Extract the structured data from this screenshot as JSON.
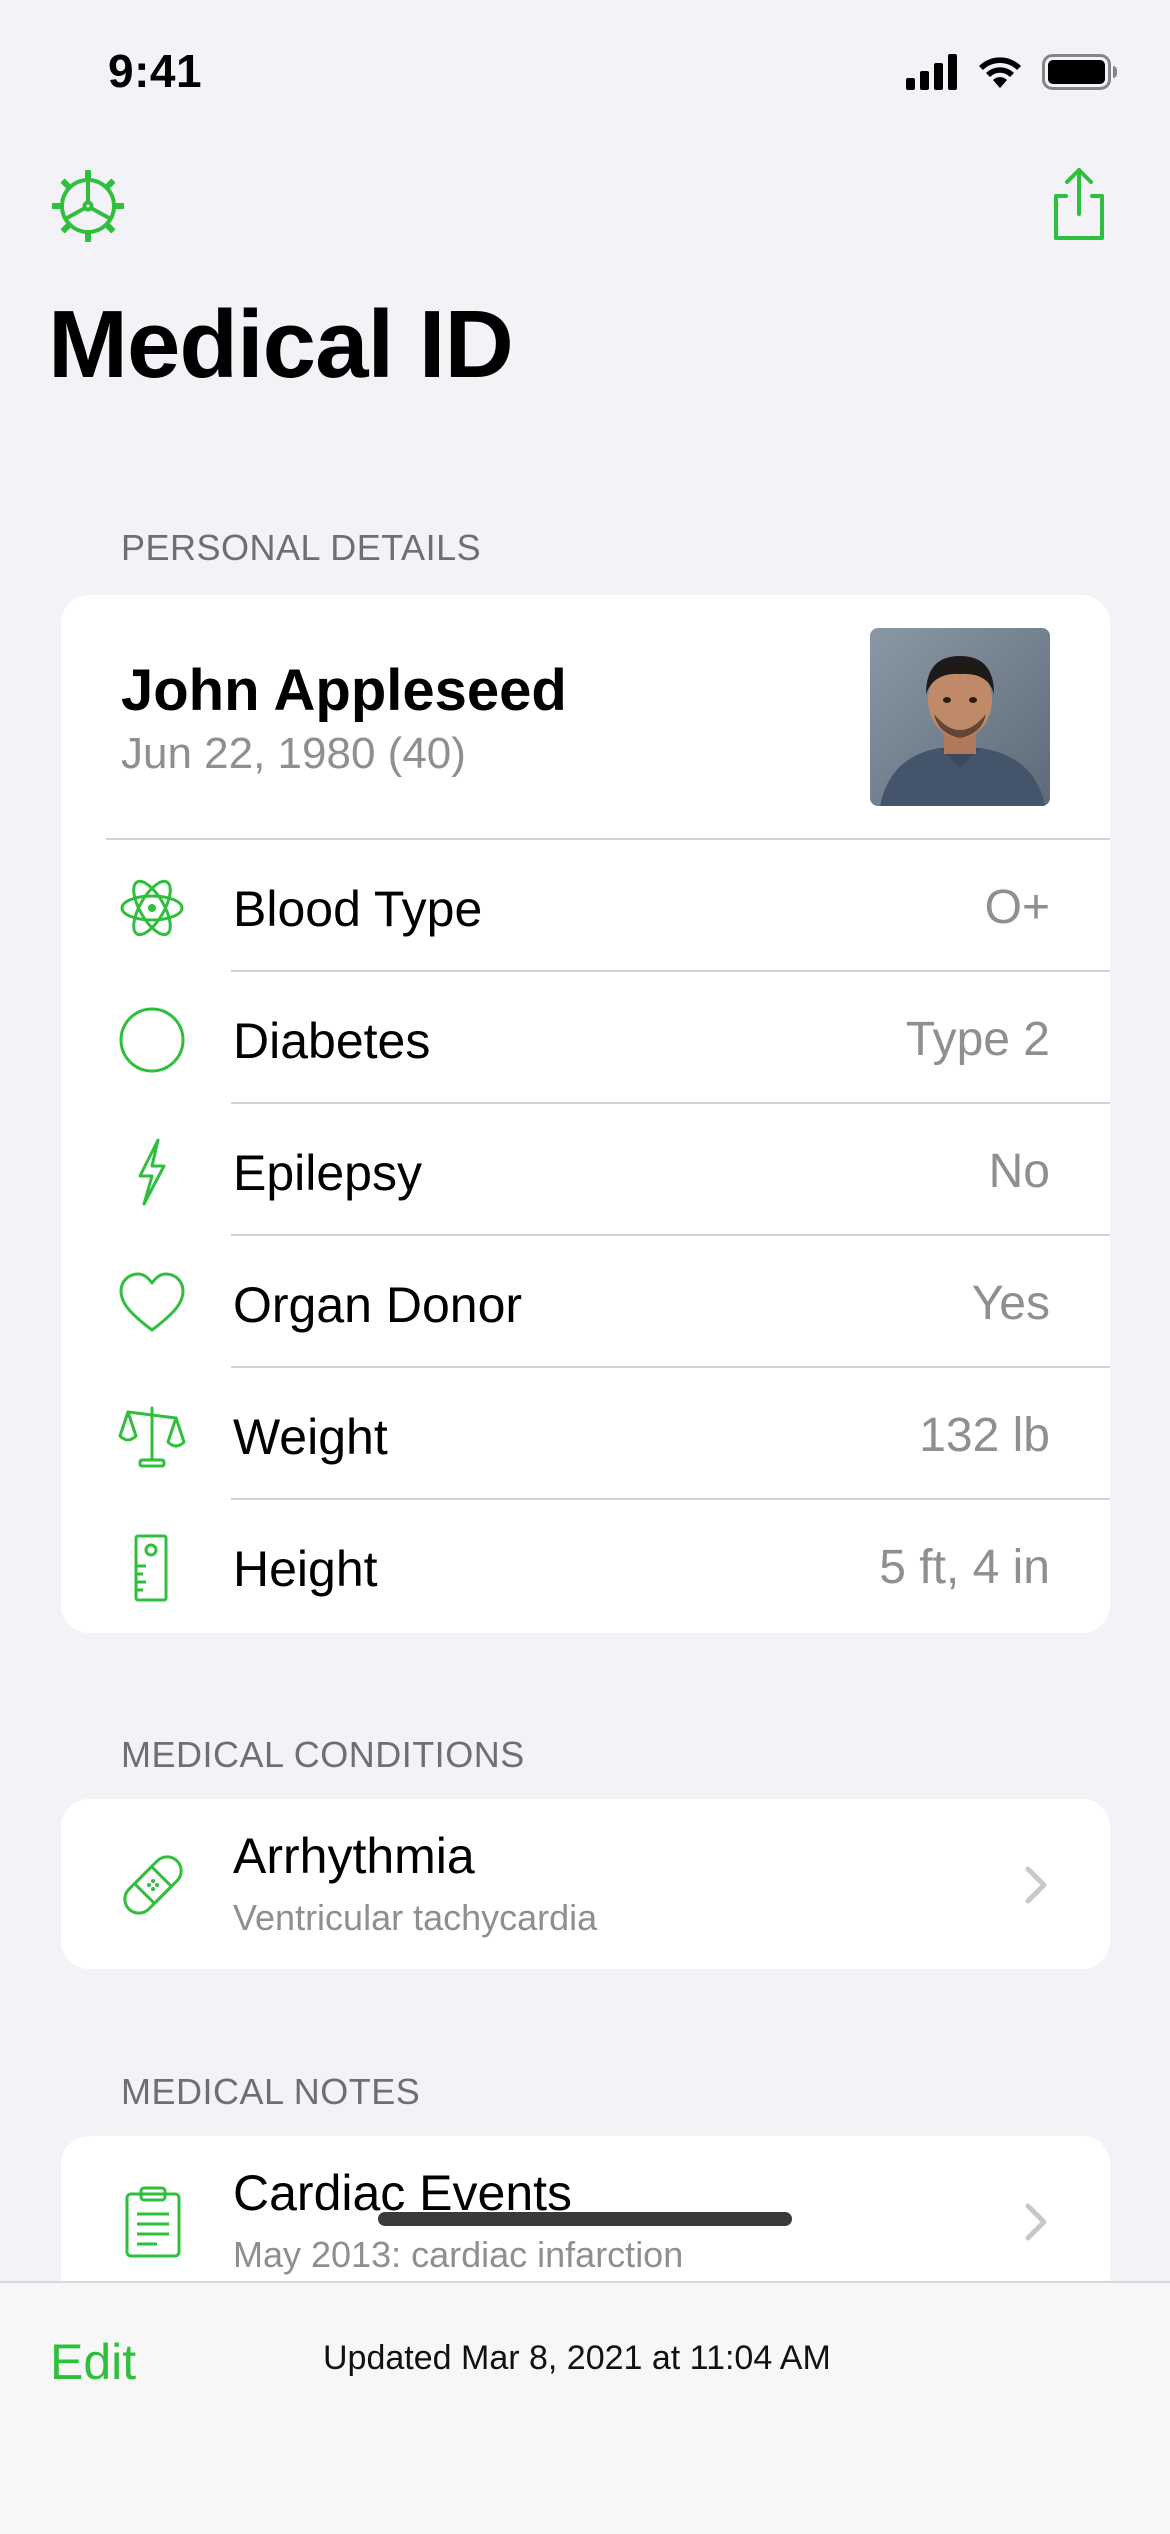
{
  "status_bar": {
    "time": "9:41"
  },
  "header": {
    "title": "Medical ID",
    "settings_icon": "gear-icon",
    "share_icon": "share-icon"
  },
  "accent_color": "#2fbf3c",
  "personal_details": {
    "section_title": "PERSONAL DETAILS",
    "name": "John Appleseed",
    "dob": "Jun 22, 1980 (40)",
    "rows": [
      {
        "label": "Blood Type",
        "value": "O+",
        "icon": "atom-icon"
      },
      {
        "label": "Diabetes",
        "value": "Type 2",
        "icon": "circle-icon"
      },
      {
        "label": "Epilepsy",
        "value": "No",
        "icon": "bolt-icon"
      },
      {
        "label": "Organ Donor",
        "value": "Yes",
        "icon": "heart-icon"
      },
      {
        "label": "Weight",
        "value": "132 lb",
        "icon": "scale-icon"
      },
      {
        "label": "Height",
        "value": "5 ft, 4 in",
        "icon": "ruler-icon"
      }
    ]
  },
  "medical_conditions": {
    "section_title": "MEDICAL CONDITIONS",
    "items": [
      {
        "title": "Arrhythmia",
        "subtitle": "Ventricular tachycardia",
        "icon": "bandage-icon"
      }
    ]
  },
  "medical_notes": {
    "section_title": "MEDICAL NOTES",
    "items": [
      {
        "title": "Cardiac Events",
        "subtitle": "May 2013: cardiac infarction",
        "icon": "clipboard-icon"
      }
    ]
  },
  "footer": {
    "edit_label": "Edit",
    "updated_text": "Updated Mar 8, 2021 at 11:04 AM"
  }
}
